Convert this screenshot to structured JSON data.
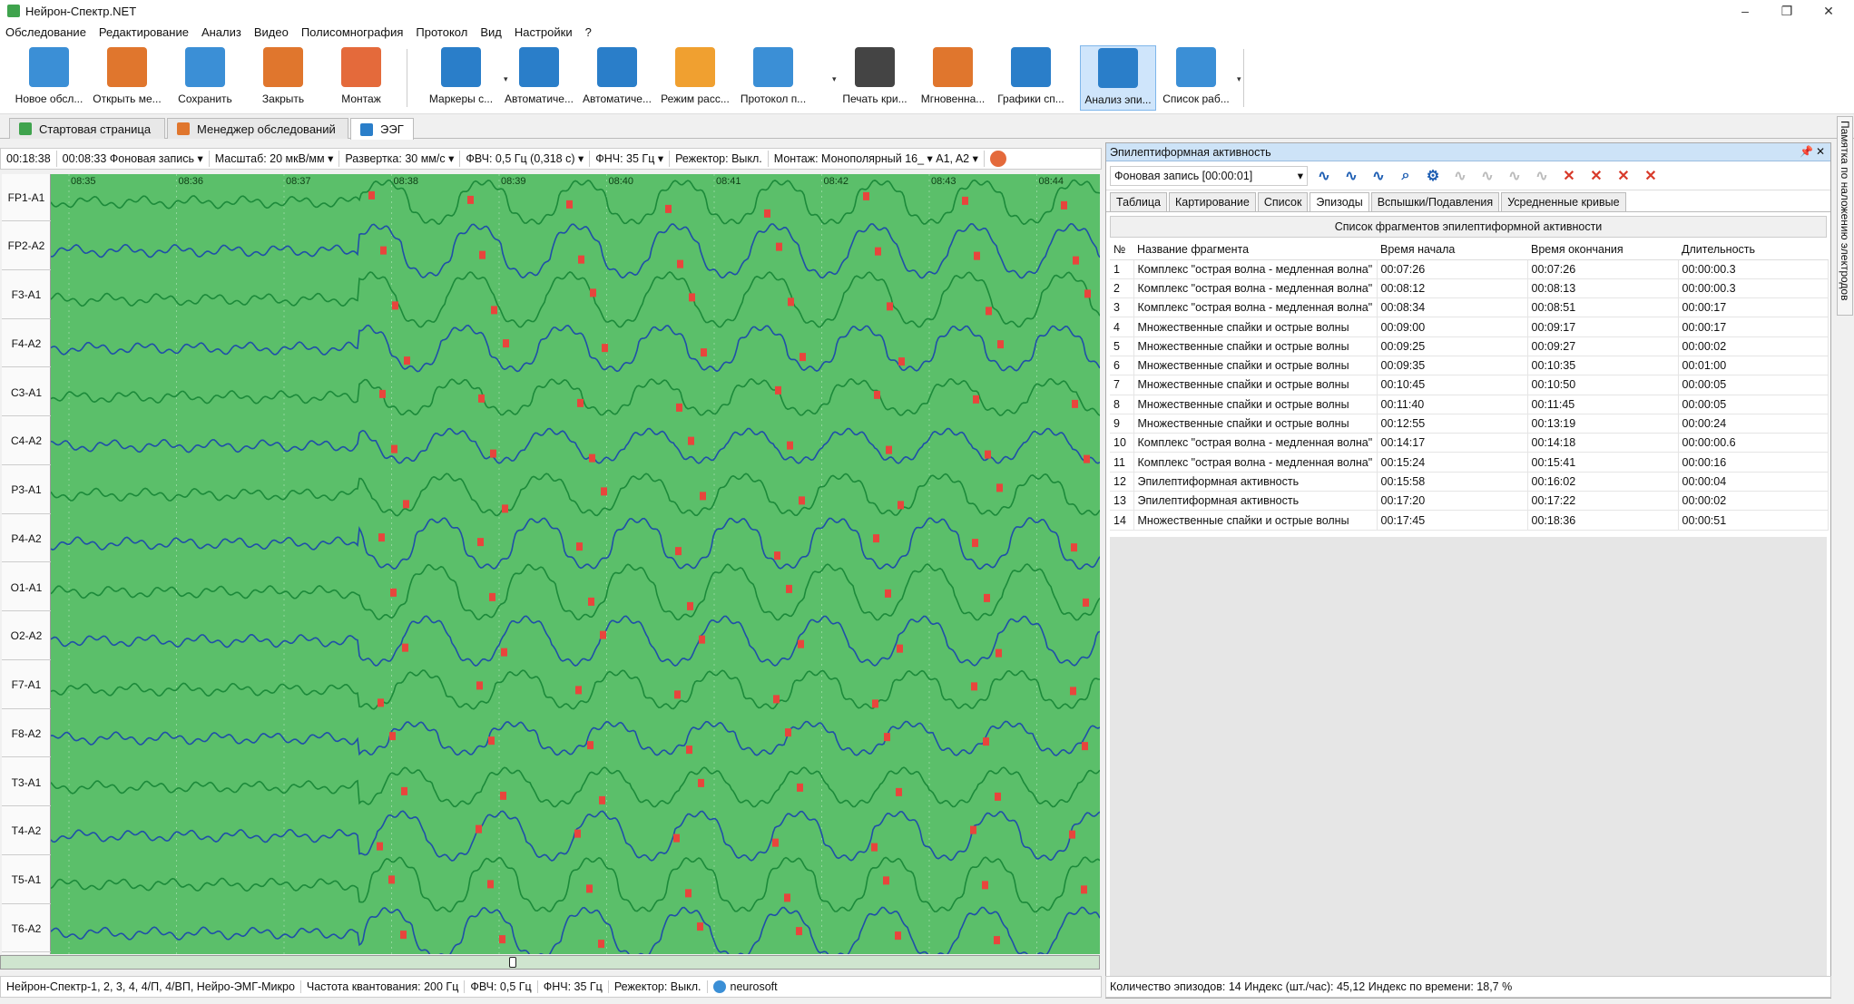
{
  "window": {
    "title": "Нейрон-Спектр.NET",
    "minimize": "–",
    "maximize": "❐",
    "close": "✕"
  },
  "menu": [
    "Обследование",
    "Редактирование",
    "Анализ",
    "Видео",
    "Полисомнография",
    "Протокол",
    "Вид",
    "Настройки",
    "?"
  ],
  "toolbar": {
    "buttons": [
      {
        "label": "Новое обсл...",
        "icon": "new-exam-icon",
        "color": "#3b8fd6"
      },
      {
        "label": "Открыть ме...",
        "icon": "open-manager-icon",
        "color": "#e0762d"
      },
      {
        "label": "Сохранить",
        "icon": "save-icon",
        "color": "#3b8fd6"
      },
      {
        "label": "Закрыть",
        "icon": "close-exam-icon",
        "color": "#e0762d"
      },
      {
        "label": "Монтаж",
        "icon": "montage-icon",
        "color": "#e46a3b"
      },
      {
        "label": "Маркеры с...",
        "icon": "markers-icon",
        "color": "#2a7ec9"
      },
      {
        "label": "Автоматиче...",
        "icon": "auto-analysis-icon",
        "color": "#2a7ec9"
      },
      {
        "label": "Автоматиче...",
        "icon": "auto-detect-icon",
        "color": "#2a7ec9"
      },
      {
        "label": "Режим расс...",
        "icon": "view-mode-icon",
        "color": "#f0a030"
      },
      {
        "label": "Протокол п...",
        "icon": "protocol-icon",
        "color": "#3b8fd6"
      },
      {
        "label": "Печать кри...",
        "icon": "print-icon",
        "color": "#444444"
      },
      {
        "label": "Мгновенна...",
        "icon": "instant-map-icon",
        "color": "#e0762d"
      },
      {
        "label": "Графики сп...",
        "icon": "spectrum-graphs-icon",
        "color": "#2a7ec9"
      },
      {
        "label": "Анализ эпи...",
        "icon": "epi-analysis-icon",
        "color": "#2a7ec9"
      },
      {
        "label": "Список раб...",
        "icon": "worklist-icon",
        "color": "#3b8fd6"
      }
    ]
  },
  "tabs": [
    {
      "label": "Стартовая страница",
      "color": "#3fa34d"
    },
    {
      "label": "Менеджер обследований",
      "color": "#e0762d"
    },
    {
      "label": "ЭЭГ",
      "color": "#2a7ec9"
    }
  ],
  "eeg_toolbar": {
    "time": "00:18:38",
    "record": "00:08:33  Фоновая запись ▾",
    "scale": "Масштаб:  20 мкВ/мм  ▾",
    "sweep": "Развертка:  30 мм/с  ▾",
    "hpf": "ФВЧ:  0,5 Гц (0,318 с)  ▾",
    "lpf": "ФНЧ:  35 Гц  ▾",
    "notch": "Режектор:  Выкл.",
    "montage": "Монтаж:  Монополярный 16_ ▾   A1, A2  ▾"
  },
  "time_ticks": [
    "08:35",
    "08:36",
    "08:37",
    "08:38",
    "08:39",
    "08:40",
    "08:41",
    "08:42",
    "08:43",
    "08:44"
  ],
  "channels": [
    "FP1-A1",
    "FP2-A2",
    "F3-A1",
    "F4-A2",
    "C3-A1",
    "C4-A2",
    "P3-A1",
    "P4-A2",
    "O1-A1",
    "O2-A2",
    "F7-A1",
    "F8-A2",
    "T3-A1",
    "T4-A2",
    "T5-A1",
    "T6-A2"
  ],
  "status_left": {
    "device": "Нейрон-Спектр-1, 2, 3, 4, 4/П, 4/ВП, Нейро-ЭМГ-Микро",
    "sampling": "Частота квантования:  200 Гц",
    "hpf": "ФВЧ:  0,5 Гц",
    "lpf": "ФНЧ:  35 Гц",
    "notch": "Режектор:  Выкл.",
    "user": "neurosoft"
  },
  "panel": {
    "title": "Эпилептиформная активность",
    "record_select": "Фоновая запись [00:00:01]",
    "tabs": [
      "Таблица",
      "Картирование",
      "Список",
      "Эпизоды",
      "Вспышки/Подавления",
      "Усредненные кривые"
    ],
    "active_tab": 3,
    "list_title": "Список фрагментов эпилептиформной активности",
    "columns": [
      "№",
      "Название фрагмента",
      "Время начала",
      "Время окончания",
      "Длительность"
    ],
    "rows": [
      [
        "1",
        "Комплекс \"острая волна - медленная волна\"",
        "00:07:26",
        "00:07:26",
        "00:00:00.3"
      ],
      [
        "2",
        "Комплекс \"острая волна - медленная волна\"",
        "00:08:12",
        "00:08:13",
        "00:00:00.3"
      ],
      [
        "3",
        "Комплекс \"острая волна - медленная волна\"",
        "00:08:34",
        "00:08:51",
        "00:00:17"
      ],
      [
        "4",
        "Множественные спайки и острые волны",
        "00:09:00",
        "00:09:17",
        "00:00:17"
      ],
      [
        "5",
        "Множественные спайки и острые волны",
        "00:09:25",
        "00:09:27",
        "00:00:02"
      ],
      [
        "6",
        "Множественные спайки и острые волны",
        "00:09:35",
        "00:10:35",
        "00:01:00"
      ],
      [
        "7",
        "Множественные спайки и острые волны",
        "00:10:45",
        "00:10:50",
        "00:00:05"
      ],
      [
        "8",
        "Множественные спайки и острые волны",
        "00:11:40",
        "00:11:45",
        "00:00:05"
      ],
      [
        "9",
        "Множественные спайки и острые волны",
        "00:12:55",
        "00:13:19",
        "00:00:24"
      ],
      [
        "10",
        "Комплекс \"острая волна - медленная волна\"",
        "00:14:17",
        "00:14:18",
        "00:00:00.6"
      ],
      [
        "11",
        "Комплекс \"острая волна - медленная волна\"",
        "00:15:24",
        "00:15:41",
        "00:00:16"
      ],
      [
        "12",
        "Эпилептиформная активность",
        "00:15:58",
        "00:16:02",
        "00:00:04"
      ],
      [
        "13",
        "Эпилептиформная активность",
        "00:17:20",
        "00:17:22",
        "00:00:02"
      ],
      [
        "14",
        "Множественные спайки и острые волны",
        "00:17:45",
        "00:18:36",
        "00:00:51"
      ]
    ],
    "status": "Количество эпизодов: 14   Индекс (шт./час): 45,12   Индекс по времени: 18,7 %"
  },
  "side_tab": "Памятка по наложению электродов",
  "colors": {
    "plot_bg": "#5bbf6a",
    "trace_blue": "#1f4fa8",
    "trace_green": "#1c8a3a",
    "marker": "#e8453c"
  }
}
